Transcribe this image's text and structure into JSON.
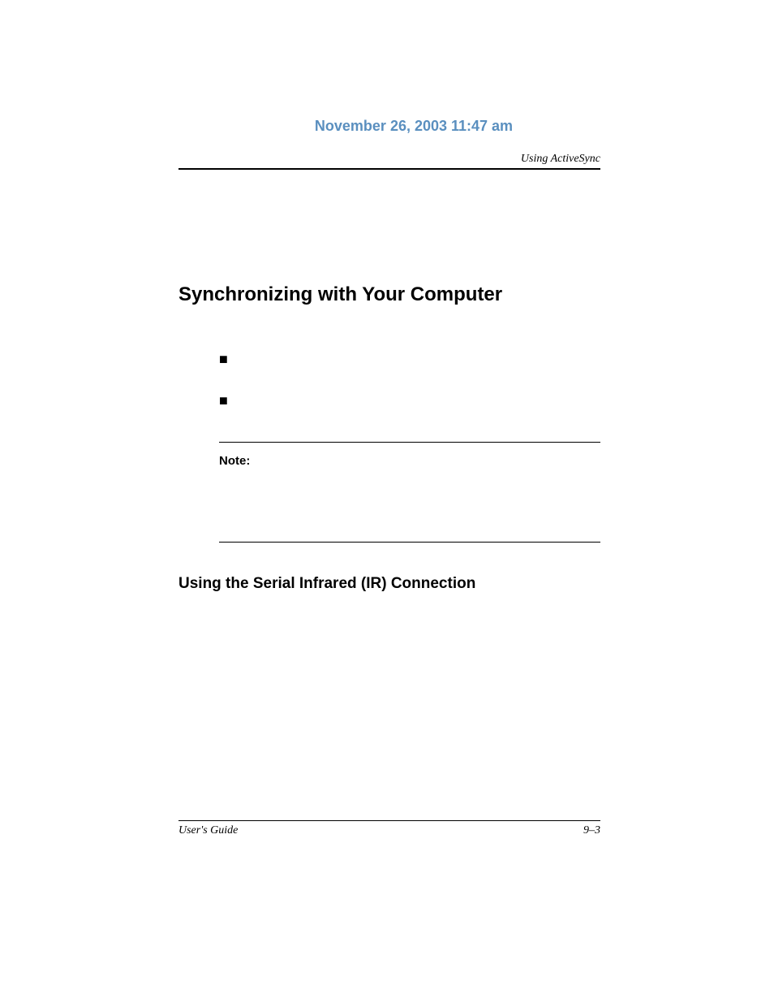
{
  "header": {
    "timestamp": "November 26, 2003 11:47 am",
    "chapter_label": "Using ActiveSync"
  },
  "content": {
    "section_title": "Synchronizing with Your Computer",
    "bullets": {
      "b1": "■",
      "b2": "■"
    },
    "note_label": "Note:",
    "subsection_title": "Using the Serial Infrared (IR) Connection"
  },
  "footer": {
    "left": "User's Guide",
    "right": "9–3"
  }
}
